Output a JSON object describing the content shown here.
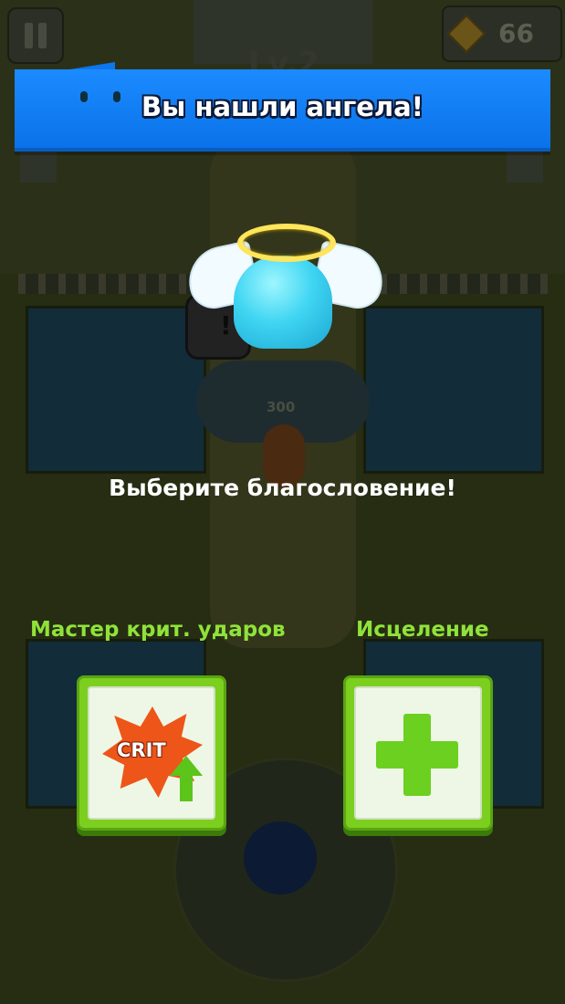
{
  "hud": {
    "level_text": "Lv.2",
    "coins": "66",
    "pause_icon": "pause-icon",
    "coin_icon": "coin-icon"
  },
  "enemy": {
    "hp": "300"
  },
  "banner": {
    "title": "Вы нашли ангела!",
    "color": "#1c8bff"
  },
  "prompt": {
    "text": "Выберите благословение!"
  },
  "choices": [
    {
      "label": "Мастер крит. ударов",
      "icon": "crit-up-icon",
      "icon_text": "CRIT"
    },
    {
      "label": "Исцеление",
      "icon": "heal-plus-icon"
    }
  ],
  "colors": {
    "accent_green": "#7ccf1f",
    "label_green": "#8fe23a",
    "crit_orange": "#ee5518"
  }
}
